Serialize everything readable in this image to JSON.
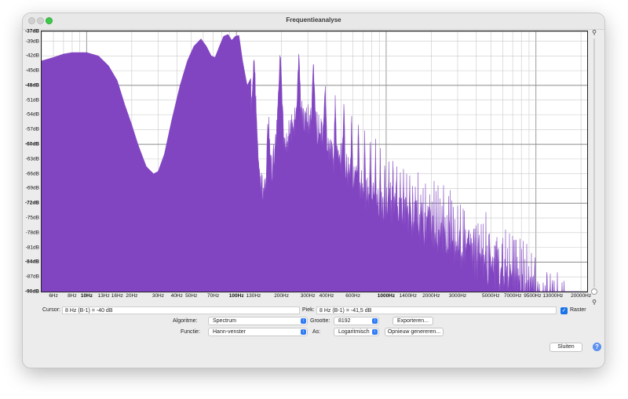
{
  "window": {
    "title": "Frequentieanalyse"
  },
  "colors": {
    "spectrum": "#8245c2",
    "grid": "#c9c9c9",
    "accent": "#1a73e8"
  },
  "chart_data": {
    "type": "area",
    "x_scale": "log",
    "xlim": [
      5,
      22000
    ],
    "ylim": [
      -90,
      -37
    ],
    "grid": true,
    "y_ticks": [
      {
        "value": -37,
        "label": "-37dB",
        "bold": true
      },
      {
        "value": -39,
        "label": "-39dB",
        "bold": false
      },
      {
        "value": -42,
        "label": "-42dB",
        "bold": false
      },
      {
        "value": -45,
        "label": "-45dB",
        "bold": false
      },
      {
        "value": -48,
        "label": "-48dB",
        "bold": true
      },
      {
        "value": -51,
        "label": "-51dB",
        "bold": false
      },
      {
        "value": -54,
        "label": "-54dB",
        "bold": false
      },
      {
        "value": -57,
        "label": "-57dB",
        "bold": false
      },
      {
        "value": -60,
        "label": "-60dB",
        "bold": true
      },
      {
        "value": -63,
        "label": "-63dB",
        "bold": false
      },
      {
        "value": -66,
        "label": "-66dB",
        "bold": false
      },
      {
        "value": -69,
        "label": "-69dB",
        "bold": false
      },
      {
        "value": -72,
        "label": "-72dB",
        "bold": true
      },
      {
        "value": -75,
        "label": "-75dB",
        "bold": false
      },
      {
        "value": -78,
        "label": "-78dB",
        "bold": false
      },
      {
        "value": -81,
        "label": "-81dB",
        "bold": false
      },
      {
        "value": -84,
        "label": "-84dB",
        "bold": true
      },
      {
        "value": -87,
        "label": "-87dB",
        "bold": false
      },
      {
        "value": -90,
        "label": "-90dB",
        "bold": true
      }
    ],
    "x_ticks": [
      {
        "value": 6,
        "label": "6Hz",
        "bold": false
      },
      {
        "value": 8,
        "label": "8Hz",
        "bold": false
      },
      {
        "value": 10,
        "label": "10Hz",
        "bold": true
      },
      {
        "value": 13,
        "label": "13Hz",
        "bold": false
      },
      {
        "value": 16,
        "label": "16Hz",
        "bold": false
      },
      {
        "value": 20,
        "label": "20Hz",
        "bold": false
      },
      {
        "value": 30,
        "label": "30Hz",
        "bold": false
      },
      {
        "value": 40,
        "label": "40Hz",
        "bold": false
      },
      {
        "value": 50,
        "label": "50Hz",
        "bold": false
      },
      {
        "value": 70,
        "label": "70Hz",
        "bold": false
      },
      {
        "value": 100,
        "label": "100Hz",
        "bold": true
      },
      {
        "value": 130,
        "label": "130Hz",
        "bold": false
      },
      {
        "value": 200,
        "label": "200Hz",
        "bold": false
      },
      {
        "value": 300,
        "label": "300Hz",
        "bold": false
      },
      {
        "value": 400,
        "label": "400Hz",
        "bold": false
      },
      {
        "value": 600,
        "label": "600Hz",
        "bold": false
      },
      {
        "value": 1000,
        "label": "1000Hz",
        "bold": true
      },
      {
        "value": 1400,
        "label": "1400Hz",
        "bold": false
      },
      {
        "value": 2000,
        "label": "2000Hz",
        "bold": false
      },
      {
        "value": 3000,
        "label": "3000Hz",
        "bold": false
      },
      {
        "value": 5000,
        "label": "5000Hz",
        "bold": false
      },
      {
        "value": 7000,
        "label": "7000Hz",
        "bold": false
      },
      {
        "value": 9500,
        "label": "9500Hz",
        "bold": false
      },
      {
        "value": 13000,
        "label": "13000Hz",
        "bold": false
      },
      {
        "value": 20000,
        "label": "20000Hz",
        "bold": false
      }
    ],
    "envelope": [
      [
        5,
        -43
      ],
      [
        6,
        -42.3
      ],
      [
        7,
        -41.6
      ],
      [
        8,
        -41.3
      ],
      [
        10,
        -41.3
      ],
      [
        12,
        -42
      ],
      [
        14,
        -44
      ],
      [
        16,
        -47
      ],
      [
        18,
        -52
      ],
      [
        20,
        -56
      ],
      [
        22,
        -60
      ],
      [
        25,
        -64.5
      ],
      [
        28,
        -66
      ],
      [
        30,
        -65.5
      ],
      [
        33,
        -62
      ],
      [
        37,
        -55
      ],
      [
        42,
        -48
      ],
      [
        47,
        -43
      ],
      [
        52,
        -40
      ],
      [
        58,
        -38.5
      ],
      [
        63,
        -40
      ],
      [
        68,
        -42
      ],
      [
        72,
        -42.3
      ],
      [
        77,
        -40
      ],
      [
        82,
        -38
      ],
      [
        88,
        -37.6
      ],
      [
        93,
        -38.8
      ],
      [
        98,
        -38
      ],
      [
        104,
        -37.8
      ],
      [
        110,
        -43
      ],
      [
        118,
        -48
      ],
      [
        125,
        -46.5
      ],
      [
        132,
        -41
      ],
      [
        140,
        -51
      ],
      [
        148,
        -55
      ],
      [
        155,
        -55
      ],
      [
        163,
        -41.5
      ],
      [
        172,
        -52
      ],
      [
        180,
        -48
      ],
      [
        195,
        -40
      ],
      [
        215,
        -45
      ],
      [
        240,
        -42
      ],
      [
        270,
        -40
      ],
      [
        300,
        -41
      ],
      [
        340,
        -42
      ],
      [
        380,
        -45
      ],
      [
        430,
        -48
      ],
      [
        500,
        -49
      ],
      [
        600,
        -52
      ],
      [
        700,
        -55
      ],
      [
        850,
        -57
      ],
      [
        1000,
        -60
      ],
      [
        1200,
        -62
      ],
      [
        1500,
        -64
      ],
      [
        2000,
        -66
      ],
      [
        2500,
        -68
      ],
      [
        3000,
        -69.5
      ],
      [
        4000,
        -72
      ],
      [
        5000,
        -74.5
      ],
      [
        6000,
        -76
      ],
      [
        7000,
        -77
      ],
      [
        8000,
        -78
      ],
      [
        10000,
        -80
      ],
      [
        12000,
        -82
      ],
      [
        14000,
        -84
      ],
      [
        16000,
        -86
      ],
      [
        18000,
        -88
      ],
      [
        19500,
        -90
      ]
    ]
  },
  "status": {
    "cursor_label": "Cursor:",
    "cursor_value": "8 Hz (B-1) = -40 dB",
    "peak_label": "Piek:",
    "peak_value": "8 Hz (B-1) = -41,5 dB",
    "grid_label": "Raster",
    "grid_checked": true
  },
  "controls": {
    "algorithm_label": "Algoritme:",
    "algorithm_value": "Spectrum",
    "function_label": "Functie:",
    "function_value": "Hann-venster",
    "size_label": "Grootte:",
    "size_value": "8192",
    "axis_label": "As:",
    "axis_value": "Logaritmisch",
    "export_label": "Exporteren...",
    "regenerate_label": "Opnieuw genereren...",
    "close_label": "Sluiten",
    "help_label": "?"
  }
}
